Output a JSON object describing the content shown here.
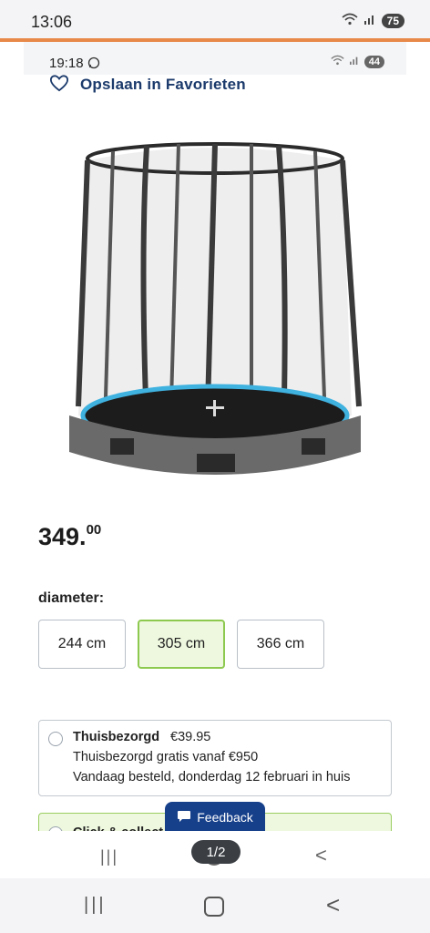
{
  "outer_status": {
    "time": "13:06",
    "battery": "75"
  },
  "inner_status": {
    "time": "19:18",
    "battery": "44"
  },
  "favorite": {
    "label": "Opslaan in Favorieten"
  },
  "price": {
    "main": "349.",
    "cents": "00"
  },
  "diameter": {
    "label": "diameter:",
    "options": [
      "244 cm",
      "305 cm",
      "366 cm"
    ],
    "selected": "305 cm"
  },
  "delivery": {
    "title": "Thuisbezorgd",
    "price": "€39.95",
    "line1": "Thuisbezorgd gratis vanaf €950",
    "line2": "Vandaag besteld, donderdag 12 februari in huis"
  },
  "click_collect": {
    "label": "Click & collect"
  },
  "feedback": {
    "label": "Feedback"
  },
  "viewer": {
    "page_counter": "1/2"
  },
  "colors": {
    "accent_blue": "#1b3a6b",
    "selected_green": "#8ec94f",
    "orange_line": "#e8894a"
  }
}
